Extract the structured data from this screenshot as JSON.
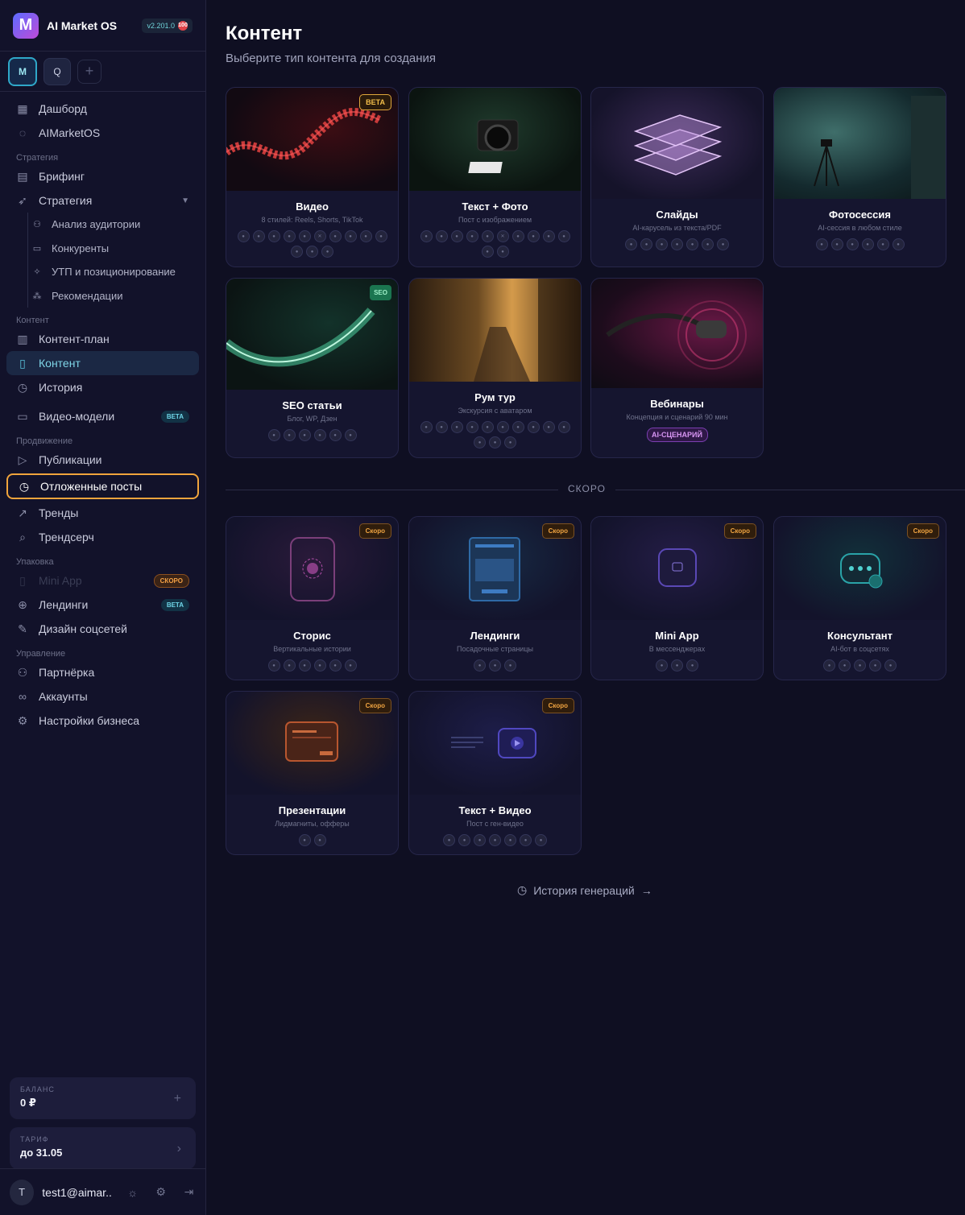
{
  "app": {
    "name": "AI Market OS",
    "version": "v2.201.0",
    "version_badge": "100"
  },
  "workspaces": [
    "M",
    "Q",
    "+"
  ],
  "nav": {
    "dashboard": "Дашборд",
    "aimarketos": "AIMarketOS",
    "sec_strategy": "Стратегия",
    "briefing": "Брифинг",
    "strategy": "Стратегия",
    "audience": "Анализ аудитории",
    "competitors": "Конкуренты",
    "usp": "УТП и позиционирование",
    "recommendations": "Рекомендации",
    "sec_content": "Контент",
    "content_plan": "Контент-план",
    "content": "Контент",
    "history": "История",
    "video_models": "Видео-модели",
    "video_models_tag": "BETA",
    "sec_promo": "Продвижение",
    "publications": "Публикации",
    "scheduled": "Отложенные посты",
    "trends": "Тренды",
    "trendsearch": "Трендсерч",
    "sec_pack": "Упаковка",
    "mini_app": "Mini App",
    "mini_app_tag": "СКОРО",
    "landings": "Лендинги",
    "landings_tag": "BETA",
    "social_design": "Дизайн соцсетей",
    "sec_manage": "Управление",
    "partner": "Партнёрка",
    "accounts": "Аккаунты",
    "business_settings": "Настройки бизнеса"
  },
  "balance": {
    "label": "БАЛАНС",
    "value": "0 ₽"
  },
  "tariff": {
    "label": "ТАРИФ",
    "value": "до 31.05"
  },
  "user": {
    "initial": "T",
    "email": "test1@aimar..."
  },
  "page": {
    "title": "Контент",
    "subtitle": "Выберите тип контента для создания",
    "soon_divider": "СКОРО",
    "history_link": "История генераций"
  },
  "cards": [
    {
      "title": "Видео",
      "desc": "8 стилей: Reels, Shorts, TikTok",
      "badge": "BETA"
    },
    {
      "title": "Текст + Фото",
      "desc": "Пост с изображением"
    },
    {
      "title": "Слайды",
      "desc": "AI-карусель из текста/PDF"
    },
    {
      "title": "Фотосессия",
      "desc": "AI-сессия в любом стиле"
    },
    {
      "title": "SEO статьи",
      "desc": "Блог, WP, Дзен",
      "badge": "SEO"
    },
    {
      "title": "Рум тур",
      "desc": "Экскурсия с аватаром"
    },
    {
      "title": "Вебинары",
      "desc": "Концепция и сценарий 90 мин",
      "pill": "AI-СЦЕНАРИЙ"
    }
  ],
  "soon_cards": [
    {
      "title": "Сторис",
      "desc": "Вертикальные истории",
      "badge": "Скоро"
    },
    {
      "title": "Лендинги",
      "desc": "Посадочные страницы",
      "badge": "Скоро"
    },
    {
      "title": "Mini App",
      "desc": "В мессенджерах",
      "badge": "Скоро"
    },
    {
      "title": "Консультант",
      "desc": "AI-бот в соцсетях",
      "badge": "Скоро"
    },
    {
      "title": "Презентации",
      "desc": "Лидмагниты, офферы",
      "badge": "Скоро"
    },
    {
      "title": "Текст + Видео",
      "desc": "Пост с ген-видео",
      "badge": "Скоро"
    }
  ]
}
